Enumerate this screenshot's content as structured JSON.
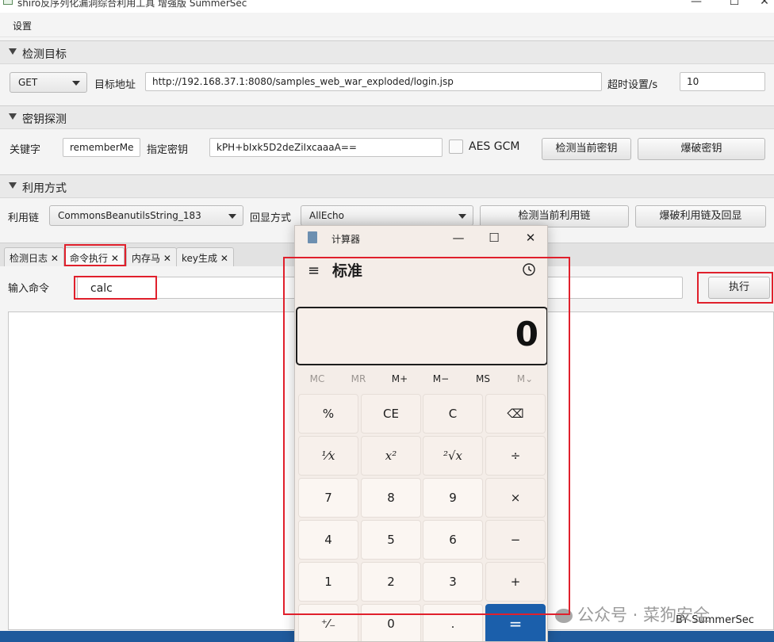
{
  "window": {
    "title": "shiro反序列化漏洞综合利用工具 增强版 SummerSec",
    "minimize": "—",
    "maximize": "☐",
    "close": "✕"
  },
  "menu": {
    "settings": "设置"
  },
  "target": {
    "section_title": "检测目标",
    "method": "GET",
    "url_label": "目标地址",
    "url_value": "http://192.168.37.1:8080/samples_web_war_exploded/login.jsp",
    "timeout_label": "超时设置/s",
    "timeout_value": "10"
  },
  "key_detect": {
    "section_title": "密钥探测",
    "keyword_label": "关键字",
    "keyword_value": "rememberMe",
    "key_label": "指定密钥",
    "key_value": "kPH+bIxk5D2deZiIxcaaaA==",
    "aes_gcm_label": "AES GCM",
    "check_key_button": "检测当前密钥",
    "brute_key_button": "爆破密钥"
  },
  "exploit": {
    "section_title": "利用方式",
    "chain_label": "利用链",
    "chain_value": "CommonsBeanutilsString_183",
    "echo_label": "回显方式",
    "echo_value": "AllEcho",
    "check_chain_button": "检测当前利用链",
    "brute_chain_button": "爆破利用链及回显"
  },
  "tabs": [
    {
      "label": "检测日志"
    },
    {
      "label": "命令执行"
    },
    {
      "label": "内存马"
    },
    {
      "label": "key生成"
    }
  ],
  "command": {
    "input_label": "输入命令",
    "input_value": "calc",
    "execute_button": "执行"
  },
  "calculator": {
    "title": "计算器",
    "mode": "标准",
    "display": "0",
    "memory": [
      "MC",
      "MR",
      "M+",
      "M−",
      "MS",
      "M⌄"
    ],
    "keys": [
      [
        "%",
        "CE",
        "C",
        "⌫"
      ],
      [
        "¹⁄x",
        "x²",
        "²√x",
        "÷"
      ],
      [
        "7",
        "8",
        "9",
        "×"
      ],
      [
        "4",
        "5",
        "6",
        "−"
      ],
      [
        "1",
        "2",
        "3",
        "+"
      ],
      [
        "⁺⁄₋",
        "0",
        ".",
        "="
      ]
    ]
  },
  "footer": {
    "by": "BY  SummerSec"
  },
  "watermark": "公众号 · 菜狗安全",
  "colors": {
    "highlight_red": "#e0202c",
    "calc_accent": "#1b5fab"
  }
}
